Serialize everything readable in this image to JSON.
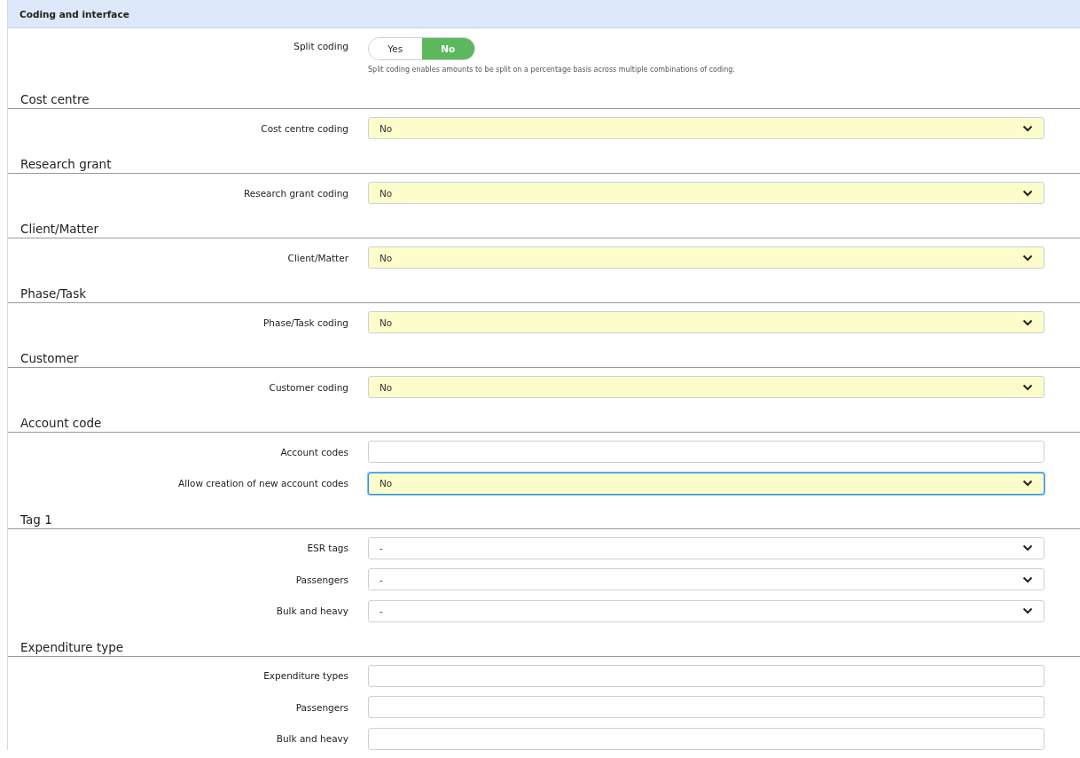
{
  "panel": {
    "title": "Coding and interface"
  },
  "split_coding": {
    "label": "Split coding",
    "options": [
      {
        "label": "Yes",
        "selected": false
      },
      {
        "label": "No",
        "selected": true
      }
    ],
    "help": "Split coding enables amounts to be split on a percentage basis across multiple combinations of coding."
  },
  "sections": [
    {
      "heading": "Cost centre",
      "fields": [
        {
          "label": "Cost centre coding",
          "kind": "select",
          "value": "No",
          "highlighted": true,
          "focused": false
        }
      ]
    },
    {
      "heading": "Research grant",
      "fields": [
        {
          "label": "Research grant coding",
          "kind": "select",
          "value": "No",
          "highlighted": true,
          "focused": false
        }
      ]
    },
    {
      "heading": "Client/Matter",
      "fields": [
        {
          "label": "Client/Matter",
          "kind": "select",
          "value": "No",
          "highlighted": true,
          "focused": false
        }
      ]
    },
    {
      "heading": "Phase/Task",
      "fields": [
        {
          "label": "Phase/Task coding",
          "kind": "select",
          "value": "No",
          "highlighted": true,
          "focused": false
        }
      ]
    },
    {
      "heading": "Customer",
      "fields": [
        {
          "label": "Customer coding",
          "kind": "select",
          "value": "No",
          "highlighted": true,
          "focused": false
        }
      ]
    },
    {
      "heading": "Account code",
      "fields": [
        {
          "label": "Account codes",
          "kind": "text",
          "highlighted": false,
          "focused": false
        },
        {
          "label": "Allow creation of new account codes",
          "kind": "select",
          "value": "No",
          "highlighted": true,
          "focused": true
        }
      ]
    },
    {
      "heading": "Tag 1",
      "fields": [
        {
          "label": "ESR tags",
          "kind": "select",
          "value": "-",
          "highlighted": false,
          "focused": false
        },
        {
          "label": "Passengers",
          "kind": "select",
          "value": "-",
          "highlighted": false,
          "focused": false
        },
        {
          "label": "Bulk and heavy",
          "kind": "select",
          "value": "-",
          "highlighted": false,
          "focused": false
        }
      ]
    },
    {
      "heading": "Expenditure type",
      "fields": [
        {
          "label": "Expenditure types",
          "kind": "text",
          "highlighted": false,
          "focused": false
        },
        {
          "label": "Passengers",
          "kind": "text",
          "highlighted": false,
          "focused": false
        },
        {
          "label": "Bulk and heavy",
          "kind": "text",
          "highlighted": false,
          "focused": false
        }
      ]
    }
  ]
}
